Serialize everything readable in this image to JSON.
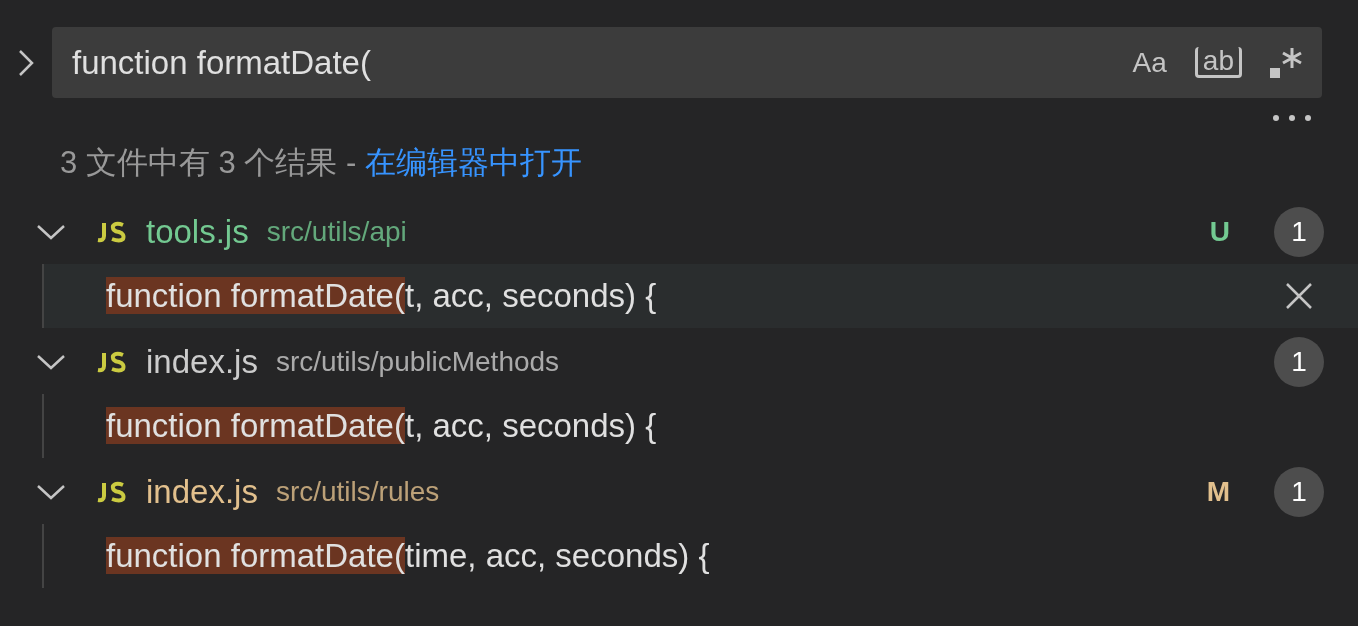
{
  "search": {
    "value": "function formatDate(",
    "expanded": false,
    "toggles": [
      {
        "kind": "case",
        "label": "Aa",
        "on": false
      },
      {
        "kind": "word",
        "label": "ab",
        "on": false
      },
      {
        "kind": "regex",
        "on": false
      }
    ]
  },
  "summary": {
    "text": "3 文件中有 3 个结果 - ",
    "link": "在编辑器中打开"
  },
  "files": [
    {
      "name": "tools.js",
      "path": "src/utils/api",
      "status": "U",
      "color": "#73c991",
      "count": "1",
      "expanded": true,
      "matches": [
        {
          "match": "function formatDate(",
          "rest": "t, acc, seconds) {",
          "selected": true
        }
      ]
    },
    {
      "name": "index.js",
      "path": "src/utils/publicMethods",
      "color": "#cccccc",
      "count": "1",
      "expanded": true,
      "matches": [
        {
          "match": "function formatDate(",
          "rest": "t, acc, seconds) {",
          "selected": false
        }
      ]
    },
    {
      "name": "index.js",
      "path": "src/utils/rules",
      "status": "M",
      "color": "#e2c08d",
      "count": "1",
      "expanded": true,
      "matches": [
        {
          "match": "function formatDate(",
          "rest": "time, acc, seconds) {",
          "selected": false
        }
      ]
    }
  ]
}
